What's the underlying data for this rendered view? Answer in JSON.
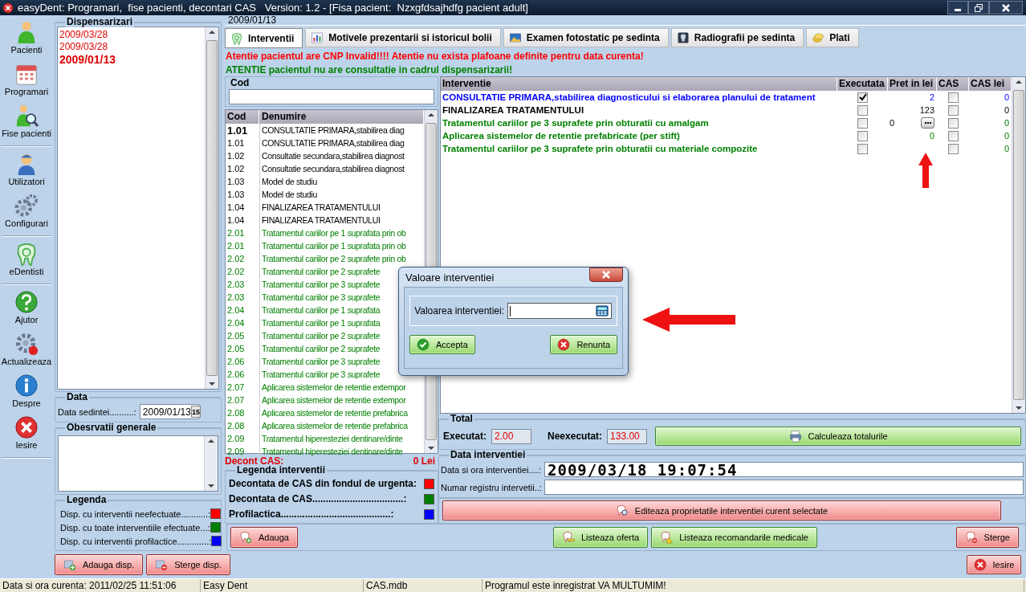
{
  "window": {
    "title": "easyDent: Programari,  fise pacienti, decontari CAS   Version: 1.2 - [Fisa pacient:  Nzxgfdsajhdfg pacient adult]"
  },
  "toolbar": [
    {
      "label": "Pacienti",
      "kind": "patient"
    },
    {
      "label": "Programari",
      "kind": "calendar"
    },
    {
      "label": "Fise pacienti",
      "kind": "search"
    },
    {
      "label": "Utilizatori",
      "kind": "user"
    },
    {
      "label": "Configurari",
      "kind": "gears"
    },
    {
      "label": "eDentisti",
      "kind": "tooth"
    },
    {
      "label": "Ajutor",
      "kind": "help"
    },
    {
      "label": "Actualizeaza",
      "kind": "update"
    },
    {
      "label": "Despre",
      "kind": "info"
    },
    {
      "label": "Iesire",
      "kind": "exit"
    }
  ],
  "dispensarizari": {
    "title": "Dispensarizari",
    "items": [
      {
        "date": "2009/03/28",
        "selected": false
      },
      {
        "date": "2009/03/28",
        "selected": false
      },
      {
        "date": "2009/01/13",
        "selected": true
      }
    ]
  },
  "data": {
    "title": "Data",
    "label": "Data sedintei..........:",
    "value": "2009/01/13",
    "calendar_day": "15"
  },
  "observatii": {
    "title": "Obesrvatii generale"
  },
  "legenda": {
    "title": "Legenda",
    "items": [
      {
        "label": "Disp. cu interventii neefectuate...........:",
        "color": "#ff0000"
      },
      {
        "label": "Disp. cu toate interventiile efectuate...:",
        "color": "#007f00"
      },
      {
        "label": "Disp. cu interventii profilactice.............:",
        "color": "#0000ff"
      }
    ]
  },
  "disp_buttons": [
    {
      "label": "Adauga disp.",
      "kind": "add"
    },
    {
      "label": "Sterge disp.",
      "kind": "delete"
    }
  ],
  "current_date": "2009/01/13",
  "tabs": [
    {
      "label": "Interventii",
      "kind": "tooth",
      "selected": true
    },
    {
      "label": "Motivele prezentarii si istoricul bolii",
      "kind": "chart",
      "selected": false
    },
    {
      "label": "Examen fotostatic pe sedinta",
      "kind": "photo",
      "selected": false
    },
    {
      "label": "Radiografii pe sedinta",
      "kind": "xray",
      "selected": false
    },
    {
      "label": "Plati",
      "kind": "money",
      "selected": false
    }
  ],
  "warnings": [
    {
      "text": "Atentie pacientul are CNP Invalid!!!! Atentie nu exista plafoane definite pentru data curenta!",
      "kind": "error"
    },
    {
      "text": "ATENTIE pacientul nu are consultatie in cadrul dispensarizarii!",
      "kind": "notice"
    }
  ],
  "code_filter": {
    "label": "Cod"
  },
  "catalog": {
    "columns": [
      "Cod",
      "Denumire"
    ],
    "rows": [
      {
        "code": "1.01",
        "name": "CONSULTATIE PRIMARA,stabilirea diag",
        "kind": "general",
        "selected": true
      },
      {
        "code": "1.01",
        "name": "CONSULTATIE PRIMARA,stabilirea diag",
        "kind": "general",
        "selected": false
      },
      {
        "code": "1.02",
        "name": "Consultatie secundara,stabilirea diagnost",
        "kind": "general",
        "selected": false
      },
      {
        "code": "1.02",
        "name": "Consultatie secundara,stabilirea diagnost",
        "kind": "general",
        "selected": false
      },
      {
        "code": "1.03",
        "name": "Model de studiu",
        "kind": "general",
        "selected": false
      },
      {
        "code": "1.03",
        "name": "Model de studiu",
        "kind": "general",
        "selected": false
      },
      {
        "code": "1.04",
        "name": "FINALIZAREA TRATAMENTULUI",
        "kind": "general",
        "selected": false
      },
      {
        "code": "1.04",
        "name": "FINALIZAREA TRATAMENTULUI",
        "kind": "general",
        "selected": false
      },
      {
        "code": "2.01",
        "name": "Tratamentul cariilor pe 1 suprafata prin ob",
        "kind": "treatment",
        "selected": false
      },
      {
        "code": "2.01",
        "name": "Tratamentul cariilor pe 1 suprafata prin ob",
        "kind": "treatment",
        "selected": false
      },
      {
        "code": "2.02",
        "name": "Tratamentul cariilor pe 2 suprafete prin ob",
        "kind": "treatment",
        "selected": false
      },
      {
        "code": "2.02",
        "name": "Tratamentul cariilor pe 2 suprafete",
        "kind": "treatment",
        "selected": false
      },
      {
        "code": "2.03",
        "name": "Tratamentul cariilor pe 3 suprafete",
        "kind": "treatment",
        "selected": false
      },
      {
        "code": "2.03",
        "name": "Tratamentul cariilor pe 3 suprafete",
        "kind": "treatment",
        "selected": false
      },
      {
        "code": "2.04",
        "name": "Tratamentul cariilor pe 1 suprafata",
        "kind": "treatment",
        "selected": false
      },
      {
        "code": "2.04",
        "name": "Tratamentul cariilor pe 1 suprafata",
        "kind": "treatment",
        "selected": false
      },
      {
        "code": "2.05",
        "name": "Tratamentul cariilor pe 2 suprafete",
        "kind": "treatment",
        "selected": false
      },
      {
        "code": "2.05",
        "name": "Tratamentul cariilor pe 2 suprafete",
        "kind": "treatment",
        "selected": false
      },
      {
        "code": "2.06",
        "name": "Tratamentul cariilor pe 3 suprafete",
        "kind": "treatment",
        "selected": false
      },
      {
        "code": "2.06",
        "name": "Tratamentul cariilor pe 3 suprafete",
        "kind": "treatment",
        "selected": false
      },
      {
        "code": "2.07",
        "name": "Aplicarea sistemelor de retentie extempor",
        "kind": "treatment",
        "selected": false
      },
      {
        "code": "2.07",
        "name": "Aplicarea sistemelor de retentie extempor",
        "kind": "treatment",
        "selected": false
      },
      {
        "code": "2.08",
        "name": "Aplicarea sistemelor de retentie prefabrica",
        "kind": "treatment",
        "selected": false
      },
      {
        "code": "2.08",
        "name": "Aplicarea sistemelor de retentie prefabrica",
        "kind": "treatment",
        "selected": false
      },
      {
        "code": "2.09",
        "name": "Tratamentul hiperesteziei dentinare/dinte",
        "kind": "treatment",
        "selected": false
      },
      {
        "code": "2.09",
        "name": "Tratamentul hiperesteziei dentinare/dinte",
        "kind": "treatment",
        "selected": false
      }
    ]
  },
  "decont": {
    "label": "Decont CAS:",
    "value": "0 Lei"
  },
  "legenda_interventii": {
    "title": "Legenda interventii",
    "items": [
      {
        "label": "Decontata de CAS din fondul de urgenta:",
        "color": "#ff0000"
      },
      {
        "label": "Decontata de CAS..................................:",
        "color": "#007f00"
      },
      {
        "label": "Profilactica.........................................:",
        "color": "#0000ff"
      }
    ]
  },
  "add_button": "Adauga",
  "interventions": {
    "columns": [
      "Interventie",
      "Executata",
      "Pret in lei",
      "CAS",
      "CAS lei"
    ],
    "rows": [
      {
        "name": "CONSULTATIE PRIMARA,stabilirea diagnosticului si elaborarea planului de tratament",
        "color": "#0000ff",
        "executed": true,
        "price": "2",
        "editing": false,
        "cas": false,
        "cas_lei": "0"
      },
      {
        "name": "FINALIZAREA TRATAMENTULUI",
        "color": "#000000",
        "executed": false,
        "price": "123",
        "editing": false,
        "cas": false,
        "cas_lei": "0"
      },
      {
        "name": "Tratamentul cariilor pe 3 suprafete prin obturatii cu amalgam",
        "color": "#008000",
        "executed": false,
        "price": "0",
        "editing": true,
        "cas": false,
        "cas_lei": "0"
      },
      {
        "name": "Aplicarea sistemelor de retentie prefabricate (per stift)",
        "color": "#008000",
        "executed": false,
        "price": "0",
        "editing": false,
        "cas": false,
        "cas_lei": "0"
      },
      {
        "name": "Tratamentul cariilor pe 3 suprafete prin obturatii cu materiale compozite",
        "color": "#008000",
        "executed": false,
        "editing": false,
        "cas": false,
        "cas_lei": "0"
      }
    ]
  },
  "total": {
    "title": "Total",
    "executed_label": "Executat:",
    "executed": "2.00",
    "pending_label": "Neexecutat:",
    "pending": "133.00",
    "button": "Calculeaza totalurile"
  },
  "data_interventiei": {
    "title": "Data interventiei",
    "fields": [
      {
        "label": "Data si ora interventiei....:",
        "value": "2009/03/18 19:07:54"
      },
      {
        "label": "Numar registru intervetii..:"
      }
    ]
  },
  "edit_button": "Editeaza proprietatile interventiei curent selectate",
  "list_buttons": [
    {
      "label": "Listeaza oferta",
      "kind": "offer"
    },
    {
      "label": "Listeaza recomandarile medicale",
      "kind": "warning"
    }
  ],
  "delete_button": "Sterge",
  "exit_button": "Iesire",
  "status_bar": [
    "Data si ora curenta: 2011/02/25 11:51:06",
    "Easy Dent",
    "CAS.mdb",
    "Programul este inregistrat VA MULTUMIM!"
  ],
  "dialog": {
    "title": "Valoare interventiei",
    "label": "Valoarea interventiei:",
    "buttons": [
      {
        "label": "Accepta",
        "kind": "ok"
      },
      {
        "label": "Renunta",
        "kind": "cancel"
      }
    ]
  }
}
